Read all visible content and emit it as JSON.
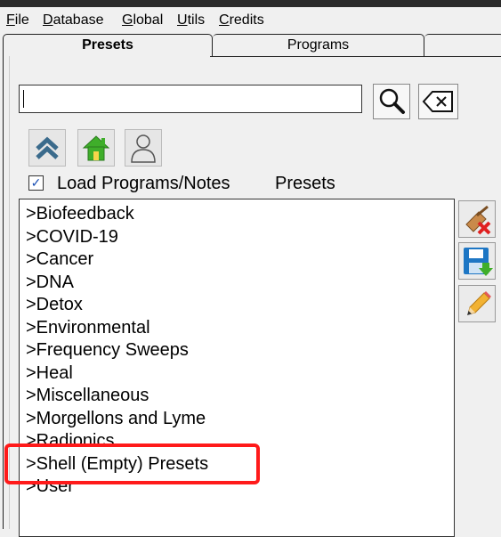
{
  "menu": {
    "items": [
      {
        "label": "File",
        "u": "F",
        "rest": "ile"
      },
      {
        "label": "Database",
        "u": "D",
        "rest": "atabase"
      },
      {
        "label": "Global",
        "u": "G",
        "rest": "lobal"
      },
      {
        "label": "Utils",
        "u": "U",
        "rest": "tils"
      },
      {
        "label": "Credits",
        "u": "C",
        "rest": "redits"
      }
    ]
  },
  "tabs": [
    {
      "label": "Presets",
      "active": true
    },
    {
      "label": "Programs",
      "active": false
    }
  ],
  "search": {
    "value": ""
  },
  "nav_buttons": [
    "chevron-up-icon",
    "home-icon",
    "user-icon"
  ],
  "load_option": {
    "checked": true,
    "label": "Load Programs/Notes",
    "section": "Presets"
  },
  "presets": [
    ">Biofeedback",
    ">COVID-19",
    ">Cancer",
    ">DNA",
    ">Detox",
    ">Environmental",
    ">Frequency Sweeps",
    ">Heal",
    ">Miscellaneous",
    ">Morgellons and Lyme",
    ">Radionics",
    ">Shell (Empty) Presets",
    ">User"
  ],
  "side_buttons": [
    "delete-icon",
    "save-icon",
    "edit-icon"
  ],
  "colors": {
    "highlight": "#ff1a1a",
    "home_green": "#3fae2a",
    "save_blue": "#1d76c4"
  }
}
